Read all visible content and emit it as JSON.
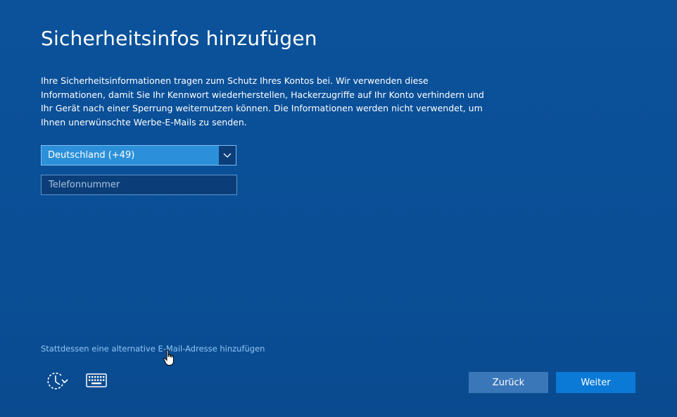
{
  "page": {
    "title": "Sicherheitsinfos hinzufügen",
    "description": "Ihre Sicherheitsinformationen tragen zum Schutz Ihres Kontos bei. Wir verwenden diese Informationen, damit Sie Ihr Kennwort wiederherstellen, Hackerzugriffe auf Ihr Konto verhindern und Ihr Gerät nach einer Sperrung weiternutzen können. Die Informationen werden nicht verwendet, um Ihnen unerwünschte Werbe-E-Mails zu senden."
  },
  "form": {
    "country_selected": "Deutschland (+49)",
    "phone_placeholder": "Telefonnummer",
    "phone_value": ""
  },
  "links": {
    "alt_email": "Stattdessen eine alternative E-Mail-Adresse hinzufügen"
  },
  "buttons": {
    "back_label": "Zurück",
    "next_label": "Weiter"
  },
  "icons": {
    "ease_of_access": "ease-of-access-icon",
    "keyboard": "keyboard-icon",
    "dropdown": "chevron-down-icon",
    "pointer": "hand-cursor-icon"
  },
  "colors": {
    "background": "#0a4f96",
    "select_bg": "#2b90d9",
    "input_bg": "#0b3e78",
    "back_button": "#3a77b9",
    "next_button": "#0a7ad6",
    "link": "#8fc6f5"
  }
}
